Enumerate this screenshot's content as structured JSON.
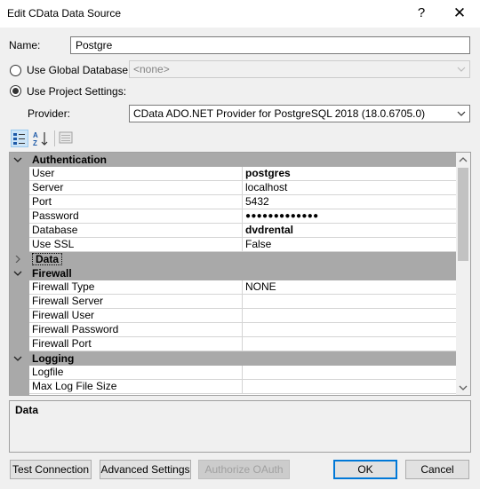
{
  "window": {
    "title": "Edit CData Data Source",
    "help": "?",
    "close": "✕"
  },
  "form": {
    "name_label": "Name:",
    "name_value": "Postgre",
    "global_db_label": "Use Global Database:",
    "global_db_value": "<none>",
    "project_settings_label": "Use Project Settings:",
    "provider_label": "Provider:",
    "provider_value": "CData ADO.NET Provider for PostgreSQL 2018 (18.0.6705.0)",
    "selected_option": "Use Project Settings"
  },
  "toolbar": [
    "categorized-icon",
    "alphabetical-icon",
    "property-pages-icon"
  ],
  "grid": {
    "authentication": {
      "title": "Authentication",
      "rows": [
        {
          "name": "User",
          "value": "postgres"
        },
        {
          "name": "Server",
          "value": "localhost"
        },
        {
          "name": "Port",
          "value": "5432"
        },
        {
          "name": "Password",
          "value": "●●●●●●●●●●●●●"
        },
        {
          "name": "Database",
          "value": "dvdrental"
        },
        {
          "name": "Use SSL",
          "value": "False"
        }
      ]
    },
    "data": {
      "title": "Data"
    },
    "firewall": {
      "title": "Firewall",
      "rows": [
        {
          "name": "Firewall Type",
          "value": "NONE"
        },
        {
          "name": "Firewall Server",
          "value": ""
        },
        {
          "name": "Firewall User",
          "value": ""
        },
        {
          "name": "Firewall Password",
          "value": ""
        },
        {
          "name": "Firewall Port",
          "value": ""
        }
      ]
    },
    "logging": {
      "title": "Logging",
      "rows": [
        {
          "name": "Logfile",
          "value": ""
        },
        {
          "name": "Max Log File Size",
          "value": ""
        }
      ]
    }
  },
  "description": {
    "title": "Data"
  },
  "buttons": {
    "test_connection": "Test Connection",
    "advanced_settings": "Advanced Settings",
    "authorize_oauth": "Authorize OAuth",
    "ok": "OK",
    "cancel": "Cancel"
  }
}
